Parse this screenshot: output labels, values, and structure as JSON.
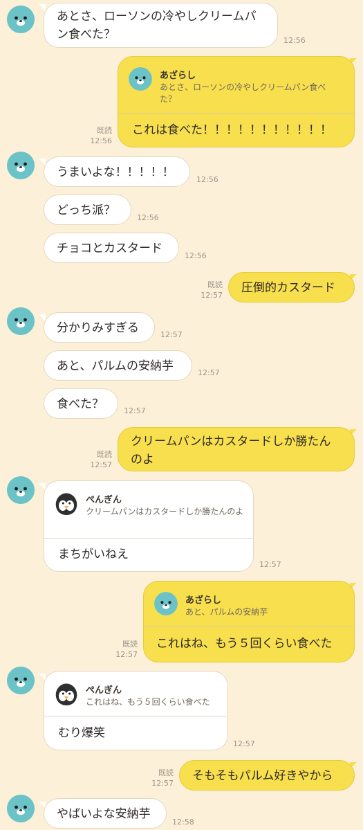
{
  "chat": {
    "messages": [
      {
        "side": "left",
        "text": "あとさ、ローソンの冷やしクリームパン食べた？",
        "time": "12:56"
      },
      {
        "side": "right",
        "quote": {
          "name": "あざらし",
          "text": "あとさ、ローソンの冷やしクリームパン食べた？"
        },
        "text": "これは食べた！！！！！！！！！！！",
        "time": "12:56",
        "read": "既読"
      },
      {
        "side": "left",
        "text": "うまいよな！！！！！",
        "time": "12:56"
      },
      {
        "side": "left",
        "text": "どっち派？",
        "time": "12:56"
      },
      {
        "side": "left",
        "text": "チョコとカスタード",
        "time": "12:56"
      },
      {
        "side": "right",
        "text": "圧倒的カスタード",
        "time": "12:57",
        "read": "既読"
      },
      {
        "side": "left",
        "text": "分かりみすぎる",
        "time": "12:57"
      },
      {
        "side": "left",
        "text": "あと、パルムの安納芋",
        "time": "12:57"
      },
      {
        "side": "left",
        "text": "食べた？",
        "time": "12:57"
      },
      {
        "side": "right",
        "text": "クリームパンはカスタードしか勝たんのよ",
        "time": "12:57",
        "read": "既読"
      },
      {
        "side": "left",
        "quote": {
          "name": "ぺんぎん",
          "text": "クリームパンはカスタードしか勝たんのよ"
        },
        "text": "まちがいねえ",
        "time": "12:57"
      },
      {
        "side": "right",
        "quote": {
          "name": "あざらし",
          "text": "あと、パルムの安納芋"
        },
        "text": "これはね、もう５回くらい食べた",
        "time": "12:57",
        "read": "既読"
      },
      {
        "side": "left",
        "quote": {
          "name": "ぺんぎん",
          "text": "これはね、もう５回くらい食べた"
        },
        "text": "むり爆笑",
        "time": "12:57"
      },
      {
        "side": "right",
        "text": "そもそもパルム好きやから",
        "time": "12:57",
        "read": "既読"
      },
      {
        "side": "left",
        "text": "やばいよな安納芋",
        "time": "12:58"
      }
    ]
  },
  "icons": {
    "partner": "seal-avatar-icon",
    "self": "penguin-avatar-icon"
  },
  "colors": {
    "background": "#fcf0d9",
    "my_bubble": "#f8df4d",
    "their_bubble": "#ffffff",
    "seal": "#6cc3c7"
  }
}
